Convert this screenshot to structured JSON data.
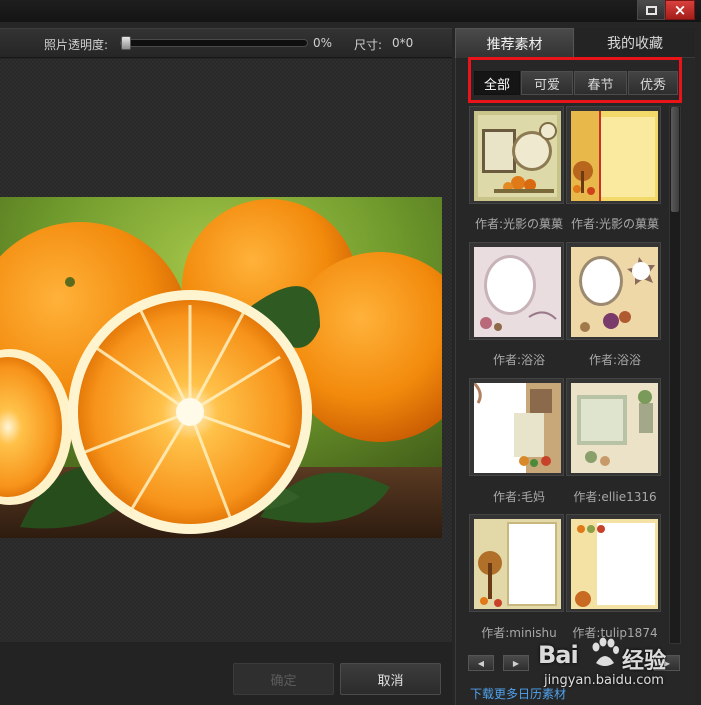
{
  "window": {
    "maximize_icon": "maximize-icon",
    "close_icon": "close-icon",
    "close_glyph": "×"
  },
  "toolbar": {
    "opacity_label": "照片透明度:",
    "opacity_value": "0%",
    "opacity_level": 0,
    "size_label": "尺寸:",
    "size_value": "0*0"
  },
  "actions": {
    "ok_label": "确定",
    "cancel_label": "取消"
  },
  "panel": {
    "tabs": [
      {
        "label": "推荐素材",
        "active": true
      },
      {
        "label": "我的收藏",
        "active": false
      }
    ],
    "categories": [
      {
        "label": "全部",
        "active": true
      },
      {
        "label": "可爱",
        "active": false
      },
      {
        "label": "春节",
        "active": false
      },
      {
        "label": "优秀",
        "active": false
      }
    ],
    "thumbnails": [
      {
        "author": "作者:光影の菓菓"
      },
      {
        "author": "作者:光影の菓菓"
      },
      {
        "author": "作者:浴浴"
      },
      {
        "author": "作者:浴浴"
      },
      {
        "author": "作者:毛妈"
      },
      {
        "author": "作者:ellie1316"
      },
      {
        "author": "作者:minishu"
      },
      {
        "author": "作者:tulip1874"
      }
    ],
    "more_link": "下载更多日历素材"
  },
  "watermark": {
    "logo": "Bai",
    "logo_suffix": "经验",
    "url": "jingyan.baidu.com"
  },
  "colors": {
    "highlight_box": "#e8141a",
    "link": "#4fa3ef",
    "close_button": "#c8322f"
  }
}
